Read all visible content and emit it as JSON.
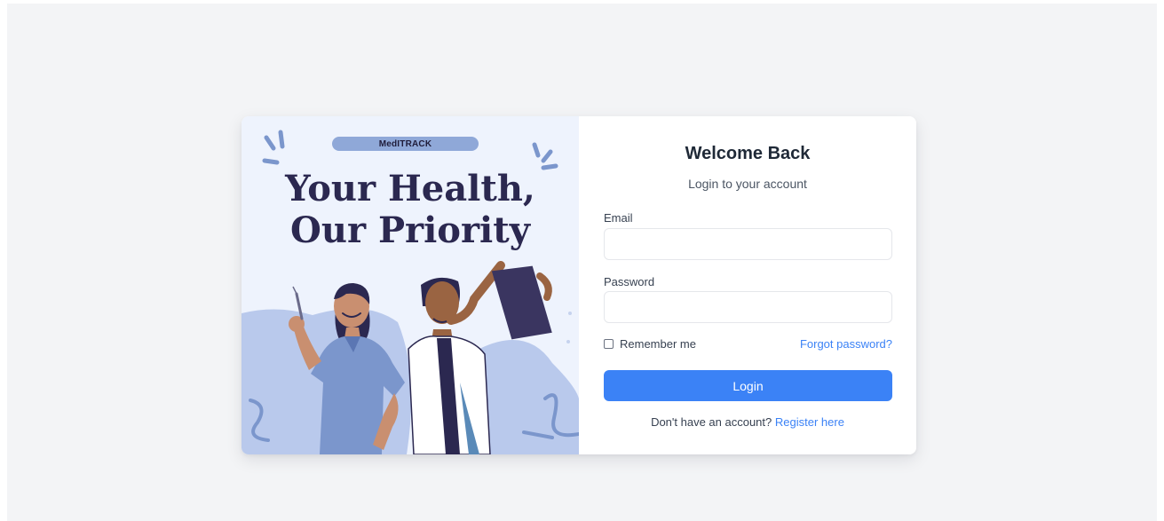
{
  "hero": {
    "brand": "MedITRACK",
    "headline_line1": "Your Health,",
    "headline_line2": "Our Priority"
  },
  "form": {
    "title": "Welcome Back",
    "subtitle": "Login to your account",
    "email_label": "Email",
    "email_value": "",
    "email_placeholder": "",
    "password_label": "Password",
    "password_value": "",
    "password_placeholder": "",
    "remember_label": "Remember me",
    "remember_checked": false,
    "forgot_label": "Forgot password?",
    "login_label": "Login",
    "register_prompt": "Don't have an account?",
    "register_link": "Register here"
  },
  "colors": {
    "accent": "#3b82f6",
    "page_background": "#f3f4f6",
    "hero_background": "#eef3fd",
    "hero_text": "#2b2850"
  }
}
